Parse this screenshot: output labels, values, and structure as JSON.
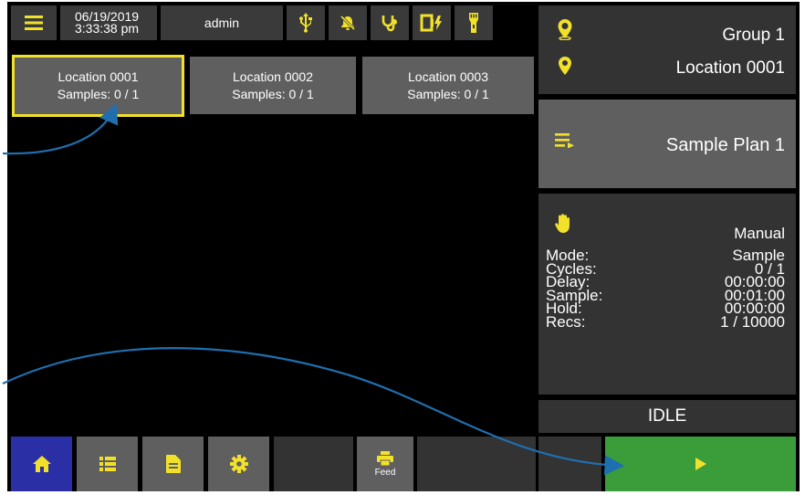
{
  "header": {
    "date": "06/19/2019",
    "time": "3:33:38 pm",
    "user": "admin"
  },
  "locations": [
    {
      "name": "Location 0001",
      "samples": "Samples: 0 / 1",
      "selected": true
    },
    {
      "name": "Location 0002",
      "samples": "Samples: 0 / 1",
      "selected": false
    },
    {
      "name": "Location 0003",
      "samples": "Samples: 0 / 1",
      "selected": false
    }
  ],
  "side": {
    "group": "Group 1",
    "location": "Location 0001",
    "plan": "Sample Plan 1",
    "mode_label": "Manual",
    "details": [
      {
        "label": "Mode:",
        "value": "Sample"
      },
      {
        "label": "Cycles:",
        "value": "0 / 1"
      },
      {
        "label": "Delay:",
        "value": "00:00:00"
      },
      {
        "label": "Sample:",
        "value": "00:01:00"
      },
      {
        "label": "Hold:",
        "value": "00:00:00"
      },
      {
        "label": "Recs:",
        "value": "1 / 10000"
      }
    ],
    "status": "IDLE"
  },
  "nav": {
    "feed_label": "Feed"
  },
  "colors": {
    "accent": "#f2e12a",
    "home_active": "#2b2fa6",
    "play": "#3a9d3a",
    "arrow": "#1f6fb0"
  }
}
